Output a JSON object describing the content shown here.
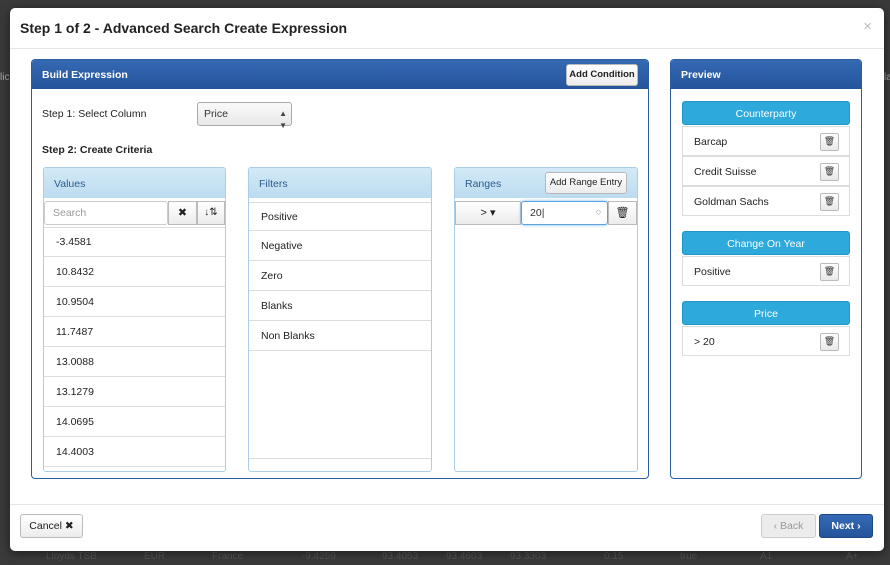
{
  "background": {
    "row": [
      "Lloyds TSB",
      "EUR",
      "France",
      "-9.4259",
      "93.4053",
      "93.4603",
      "93.3303",
      "0.15",
      "true",
      "A1",
      "A+"
    ],
    "left_edge": [
      "lic",
      "c"
    ],
    "right_edge": [
      "la",
      "e"
    ]
  },
  "modal": {
    "title": "Step 1 of 2 - Advanced Search Create Expression",
    "close": "×"
  },
  "build": {
    "title": "Build Expression",
    "add_condition": "Add Condition",
    "step1_label": "Step 1: Select Column",
    "column_select": "Price",
    "step2_label": "Step 2: Create Criteria"
  },
  "values": {
    "title": "Values",
    "search_placeholder": "Search",
    "clear_icon": "✖",
    "sort_icon": "↓⇅",
    "items": [
      "-3.4581",
      "10.8432",
      "10.9504",
      "11.7487",
      "13.0088",
      "13.1279",
      "14.0695",
      "14.4003"
    ]
  },
  "filters": {
    "title": "Filters",
    "items": [
      "Positive",
      "Negative",
      "Zero",
      "Blanks",
      "Non Blanks"
    ]
  },
  "ranges": {
    "title": "Ranges",
    "add_range": "Add Range Entry",
    "operator": "> ▾",
    "value": "20"
  },
  "preview": {
    "title": "Preview",
    "groups": [
      {
        "label": "Counterparty",
        "items": [
          "Barcap",
          "Credit Suisse",
          "Goldman Sachs"
        ]
      },
      {
        "label": "Change On Year",
        "items": [
          "Positive"
        ]
      },
      {
        "label": "Price",
        "items": [
          "> 20"
        ]
      }
    ]
  },
  "footer": {
    "cancel": "Cancel ✖",
    "back": "‹ Back",
    "next": "Next ›"
  },
  "colors": {
    "panel_header": "#24559b",
    "preview_group": "#2da9dc",
    "next_button": "#24559b",
    "column_header": "#bcdcef"
  }
}
